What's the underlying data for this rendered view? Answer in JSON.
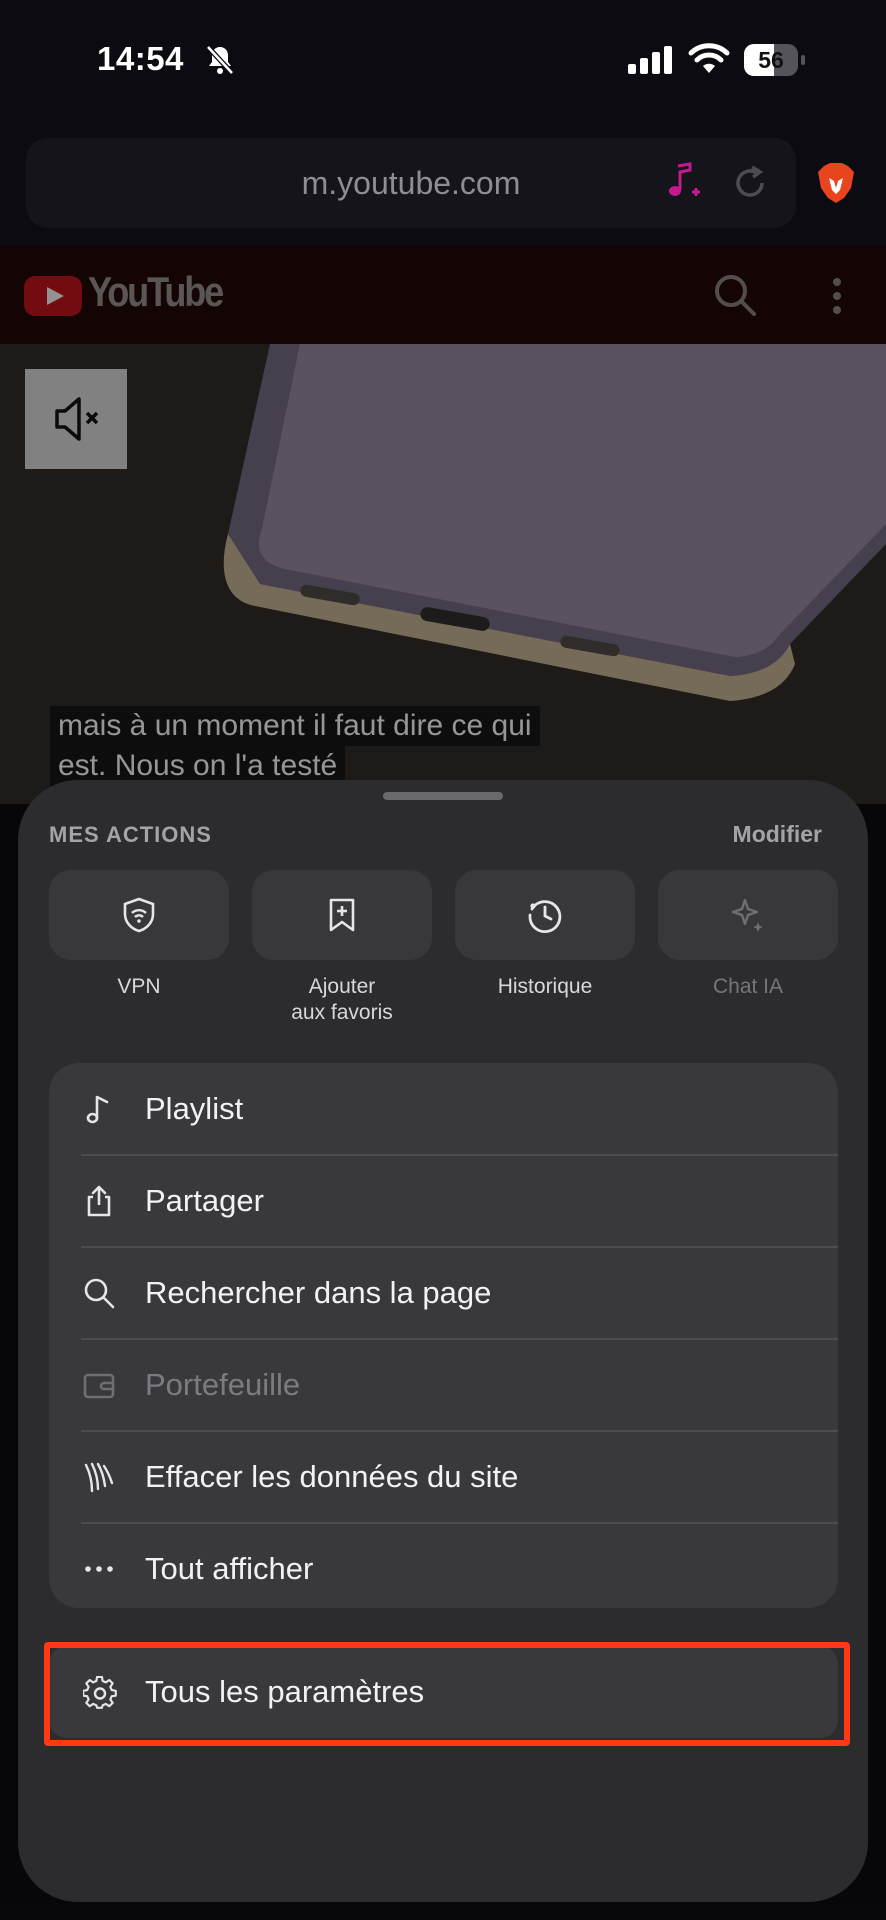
{
  "status_bar": {
    "time": "14:54",
    "battery_label": "56",
    "battery_level": 0.56,
    "icons": [
      "bell-slash-icon",
      "signal-icon",
      "wifi-icon",
      "battery-icon"
    ]
  },
  "browser": {
    "url": "m.youtube.com",
    "icons": [
      "music-plus-icon",
      "reload-icon",
      "brave-lion-icon"
    ]
  },
  "youtube": {
    "wordmark": "YouTube",
    "icons": [
      "youtube-logo-icon",
      "search-icon",
      "more-vertical-icon"
    ]
  },
  "video": {
    "subtitle_line_1": "mais à un moment il faut dire ce qui",
    "subtitle_line_2": "est. Nous on l'a testé",
    "icons": [
      "mute-icon"
    ]
  },
  "sheet": {
    "actions_title": "MES ACTIONS",
    "edit_label": "Modifier",
    "actions": [
      {
        "label": "VPN",
        "icon": "shield-wifi-icon",
        "enabled": true
      },
      {
        "label_line_1": "Ajouter",
        "label_line_2": "aux favoris",
        "icon": "bookmark-add-icon",
        "enabled": true
      },
      {
        "label": "Historique",
        "icon": "history-icon",
        "enabled": true
      },
      {
        "label": "Chat IA",
        "icon": "sparkle-icon",
        "enabled": false
      }
    ],
    "menu": [
      {
        "label": "Playlist",
        "icon": "music-note-icon",
        "enabled": true
      },
      {
        "label": "Partager",
        "icon": "share-icon",
        "enabled": true
      },
      {
        "label": "Rechercher dans la page",
        "icon": "search-icon",
        "enabled": true
      },
      {
        "label": "Portefeuille",
        "icon": "wallet-icon",
        "enabled": false
      },
      {
        "label": "Effacer les données du site",
        "icon": "clear-data-icon",
        "enabled": true
      },
      {
        "label": "Tout afficher",
        "icon": "more-horizontal-icon",
        "enabled": true
      }
    ],
    "settings": {
      "label": "Tous les paramètres",
      "icon": "gear-icon",
      "highlighted": true
    }
  },
  "colors": {
    "highlight": "#ff3a12",
    "youtube_red": "#b0131a",
    "sheet_bg": "#2c2c2f",
    "group_bg": "#39393d"
  }
}
